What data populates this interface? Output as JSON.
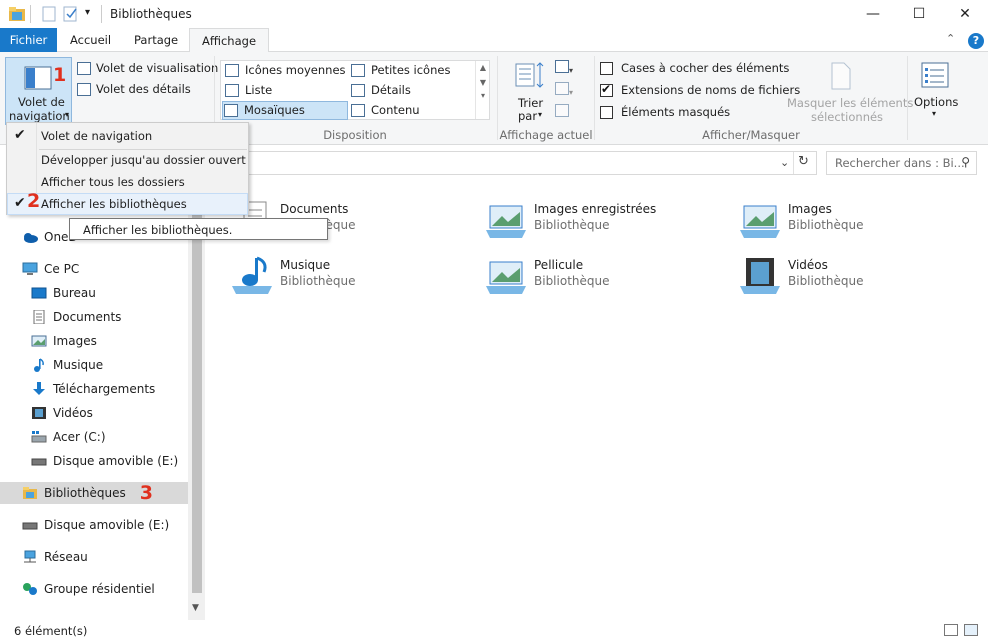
{
  "window": {
    "title": "Bibliothèques",
    "minimize": "—",
    "maximize": "☐",
    "close": "✕"
  },
  "tabs": [
    {
      "label": "Fichier"
    },
    {
      "label": "Accueil"
    },
    {
      "label": "Partage"
    },
    {
      "label": "Affichage"
    }
  ],
  "ribbon": {
    "nav_pane_button": [
      "Volet de",
      "navigation"
    ],
    "preview_pane": "Volet de visualisation",
    "details_pane": "Volet des détails",
    "layout": {
      "items": [
        "Icônes moyennes",
        "Petites icônes",
        "Liste",
        "Détails",
        "Mosaïques",
        "Contenu"
      ],
      "label": "Disposition"
    },
    "current_view": {
      "sort_by": [
        "Trier",
        "par"
      ],
      "label": "Affichage actuel"
    },
    "show_hide": {
      "checkboxes": [
        "Cases à cocher des éléments",
        "Extensions de noms de fichiers",
        "Éléments masqués"
      ],
      "checked": [
        false,
        true,
        false
      ],
      "hide_selected": [
        "Masquer les éléments",
        "sélectionnés"
      ],
      "label": "Afficher/Masquer"
    },
    "options": "Options"
  },
  "navmenu": {
    "items": [
      {
        "label": "Volet de navigation",
        "checked": true
      },
      {
        "label": "Développer jusqu'au dossier ouvert",
        "checked": false
      },
      {
        "label": "Afficher tous les dossiers",
        "checked": false
      },
      {
        "label": "Afficher les bibliothèques",
        "checked": true
      }
    ],
    "tooltip": "Afficher les bibliothèques."
  },
  "annotations": [
    "1",
    "2",
    "3"
  ],
  "search": {
    "placeholder": "Rechercher dans : Bi..."
  },
  "navpane": {
    "items": [
      {
        "label": "OneD",
        "icon": "onedrive-icon"
      },
      {
        "label": "Ce PC",
        "icon": "computer-icon"
      },
      {
        "label": "Bureau",
        "icon": "desktop-icon"
      },
      {
        "label": "Documents",
        "icon": "documents-icon"
      },
      {
        "label": "Images",
        "icon": "pictures-icon"
      },
      {
        "label": "Musique",
        "icon": "music-icon"
      },
      {
        "label": "Téléchargements",
        "icon": "download-icon"
      },
      {
        "label": "Vidéos",
        "icon": "video-icon"
      },
      {
        "label": "Acer (C:)",
        "icon": "drive-icon"
      },
      {
        "label": "Disque amovible (E:)",
        "icon": "usb-drive-icon"
      },
      {
        "label": "Bibliothèques",
        "icon": "libraries-icon"
      },
      {
        "label": "Disque amovible (E:)",
        "icon": "usb-drive-icon"
      },
      {
        "label": "Réseau",
        "icon": "network-icon"
      },
      {
        "label": "Groupe résidentiel",
        "icon": "homegroup-icon"
      }
    ]
  },
  "tiles": [
    {
      "name": "Documents",
      "type": "Bibliothèque",
      "icon": "documents-library-icon"
    },
    {
      "name": "Images enregistrées",
      "type": "Bibliothèque",
      "icon": "saved-pictures-icon"
    },
    {
      "name": "Images",
      "type": "Bibliothèque",
      "icon": "pictures-library-icon"
    },
    {
      "name": "Musique",
      "type": "Bibliothèque",
      "icon": "music-library-icon"
    },
    {
      "name": "Pellicule",
      "type": "Bibliothèque",
      "icon": "camera-roll-icon"
    },
    {
      "name": "Vidéos",
      "type": "Bibliothèque",
      "icon": "videos-library-icon"
    }
  ],
  "status": {
    "count": "6 élément(s)"
  },
  "colors": {
    "accent": "#1979ca",
    "annotation": "#e0301e"
  }
}
